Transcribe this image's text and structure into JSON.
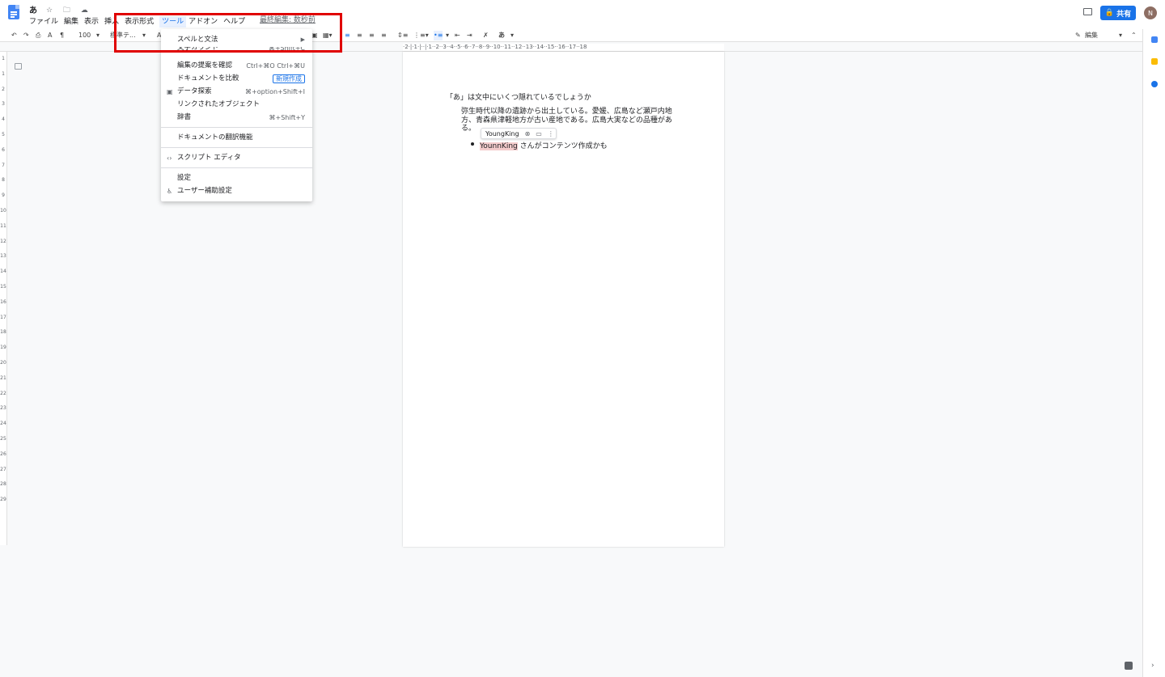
{
  "header": {
    "title": "あ",
    "title_icons": "☆ 🗀 ☁",
    "menus": [
      "ファイル",
      "編集",
      "表示",
      "挿入",
      "表示形式",
      "ツール",
      "アドオン",
      "ヘルプ"
    ],
    "active_menu": "ツール",
    "last_edit": "最終編集: 数秒前",
    "share_label": "共有",
    "avatar_initial": "N"
  },
  "toolbar": {
    "zoom": "100",
    "style": "標準テ...",
    "style_prefix": "A",
    "input_mode": "あ",
    "edit_mode": "編集"
  },
  "ruler": {
    "horizontal": "·2·|·1·|··|·1··2··3··4··5··6··7··8··9··10··11··12··13··14··15··16··17··18",
    "vertical": [
      "1",
      "1",
      "2",
      "3",
      "4",
      "5",
      "6",
      "7",
      "8",
      "9",
      "10",
      "11",
      "12",
      "13",
      "14",
      "15",
      "16",
      "17",
      "18",
      "19",
      "20",
      "21",
      "22",
      "23",
      "24",
      "25",
      "26",
      "27",
      "28",
      "29"
    ]
  },
  "document": {
    "title_line": "「あ」は文中にいくつ隠れているでしょうか",
    "body": "弥生時代以降の遺跡から出土している。愛媛、広島など瀬戸内地方、青森県津軽地方が古い産地である。広島大実などの品種がある。",
    "suggestion_author": "YoungKing",
    "bullet_name": "YounnKing",
    "bullet_rest": " さんがコンテンツ作成かも"
  },
  "tools_menu": {
    "spell": "スペルと文法",
    "word_count": "文字カウント",
    "word_count_sc": "⌘+Shift+C",
    "review": "編集の提案を確認",
    "review_sc": "Ctrl+⌘O Ctrl+⌘U",
    "compare": "ドキュメントを比較",
    "compare_badge": "新規作成",
    "explore": "データ探索",
    "explore_sc": "⌘+option+Shift+I",
    "linked": "リンクされたオブジェクト",
    "dictionary": "辞書",
    "dictionary_sc": "⌘+Shift+Y",
    "translate": "ドキュメントの翻訳機能",
    "script": "スクリプト エディタ",
    "settings": "設定",
    "accessibility": "ユーザー補助設定"
  },
  "colors": {
    "accent": "#1a73e8",
    "highlight_box": "#e00000",
    "suggestion_bg": "#f4cccc"
  }
}
